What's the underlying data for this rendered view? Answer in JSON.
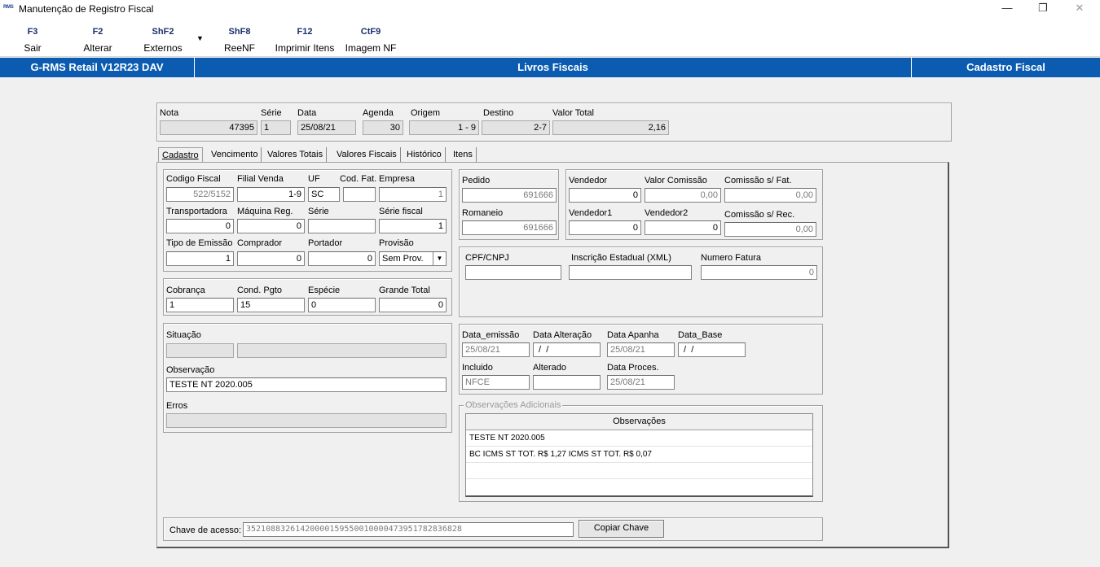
{
  "window": {
    "app_icon_text": "RMS",
    "title": "Manutenção de Registro Fiscal",
    "minimize": "—",
    "maximize": "❐",
    "close": "✕"
  },
  "toolbar": [
    {
      "key": "F3",
      "label": "Sair"
    },
    {
      "key": "F2",
      "label": "Alterar"
    },
    {
      "key": "ShF2",
      "label": "Externos"
    },
    {
      "key": "ShF8",
      "label": "ReeNF"
    },
    {
      "key": "F12",
      "label": "Imprimir Itens"
    },
    {
      "key": "CtF9",
      "label": "Imagem NF"
    }
  ],
  "toolbar_dropdown": "▼",
  "header": {
    "left": "G-RMS Retail V12R23 DAV",
    "center": "Livros Fiscais",
    "right": "Cadastro Fiscal"
  },
  "top_fields": {
    "nota": {
      "label": "Nota",
      "value": "47395"
    },
    "serie": {
      "label": "Série",
      "value": "1"
    },
    "data": {
      "label": "Data",
      "value": "25/08/21"
    },
    "agenda": {
      "label": "Agenda",
      "value": "30"
    },
    "origem": {
      "label": "Origem",
      "value": "1 - 9"
    },
    "destino": {
      "label": "Destino",
      "value": "2-7"
    },
    "valor_total": {
      "label": "Valor Total",
      "value": "2,16"
    }
  },
  "tabs": [
    "Cadastro",
    "Vencimento",
    "Valores Totais",
    "Valores Fiscais",
    "Histórico",
    "Itens"
  ],
  "cadastro": {
    "codigo_fiscal": {
      "label": "Codigo Fiscal",
      "value": "522/5152"
    },
    "filial_venda": {
      "label": "Filial Venda",
      "value": "1-9"
    },
    "uf": {
      "label": "UF",
      "value": "SC"
    },
    "cod_fat": {
      "label": "Cod. Fat.",
      "value": ""
    },
    "empresa": {
      "label": "Empresa",
      "value": "1"
    },
    "transportadora": {
      "label": "Transportadora",
      "value": "0"
    },
    "maquina_reg": {
      "label": "Máquina Reg.",
      "value": "0"
    },
    "serie": {
      "label": "Série",
      "value": ""
    },
    "serie_fiscal": {
      "label": "Série fiscal",
      "value": "1"
    },
    "tipo_emissao": {
      "label": "Tipo de Emissão",
      "value": "1"
    },
    "comprador": {
      "label": "Comprador",
      "value": "0"
    },
    "portador": {
      "label": "Portador",
      "value": "0"
    },
    "provisao": {
      "label": "Provisão",
      "value": "Sem Prov."
    }
  },
  "cobranca": {
    "cobranca": {
      "label": "Cobrança",
      "value": "1"
    },
    "cond_pgto": {
      "label": "Cond. Pgto",
      "value": "15"
    },
    "especie": {
      "label": "Espécie",
      "value": "0"
    },
    "grande_total": {
      "label": "Grande Total",
      "value": "0"
    }
  },
  "situacao": {
    "situacao_label": "Situação",
    "observacao_label": "Observação",
    "observacao_value": "TESTE NT 2020.005",
    "erros_label": "Erros"
  },
  "pedido": {
    "pedido": {
      "label": "Pedido",
      "value": "691666"
    },
    "romaneio": {
      "label": "Romaneio",
      "value": "691666"
    }
  },
  "vendedor": {
    "vendedor": {
      "label": "Vendedor",
      "value": "0"
    },
    "valor_comissao": {
      "label": "Valor Comissão",
      "value": "0,00"
    },
    "comissao_fat": {
      "label": "Comissão s/ Fat.",
      "value": "0,00"
    },
    "vendedor1": {
      "label": "Vendedor1",
      "value": "0"
    },
    "vendedor2": {
      "label": "Vendedor2",
      "value": "0"
    },
    "comissao_rec": {
      "label": "Comissão s/ Rec.",
      "value": "0,00"
    }
  },
  "cpf": {
    "cpf_cnpj": {
      "label": "CPF/CNPJ",
      "value": ""
    },
    "inscricao": {
      "label": "Inscrição Estadual (XML)",
      "value": ""
    },
    "numero_fatura": {
      "label": "Numero Fatura",
      "value": "0"
    }
  },
  "datas": {
    "data_emissao": {
      "label": "Data_emissão",
      "value": "25/08/21"
    },
    "data_alteracao": {
      "label": "Data Alteração",
      "value": " /  /"
    },
    "data_apanha": {
      "label": "Data Apanha",
      "value": "25/08/21"
    },
    "data_base": {
      "label": "Data_Base",
      "value": " /  /"
    },
    "incluido": {
      "label": "Incluido",
      "value": "NFCE"
    },
    "alterado": {
      "label": "Alterado",
      "value": ""
    },
    "data_proces": {
      "label": "Data Proces.",
      "value": "25/08/21"
    }
  },
  "obs_adicionais": {
    "group_label": "Observações Adicionais",
    "column": "Observações",
    "rows": [
      "TESTE NT 2020.005",
      "BC ICMS ST TOT. R$ 1,27 ICMS ST TOT. R$ 0,07"
    ]
  },
  "chave": {
    "label": "Chave de acesso:",
    "value": "35210883261420000159550010000473951782836828",
    "button": "Copiar Chave"
  }
}
